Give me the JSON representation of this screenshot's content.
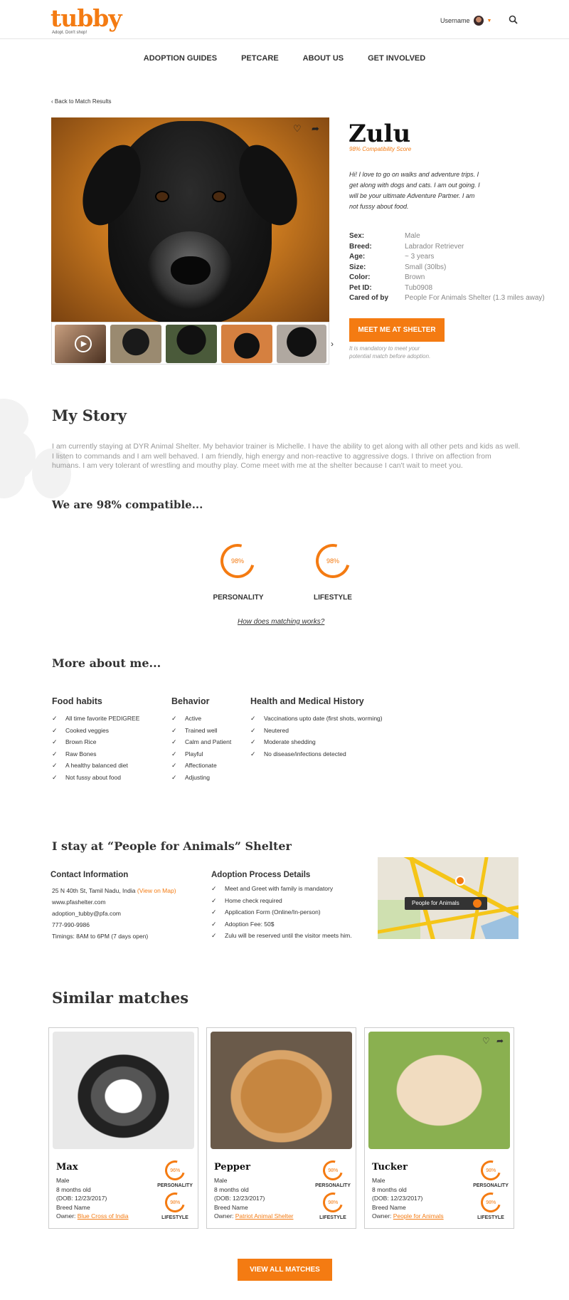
{
  "header": {
    "logo": "tubby",
    "tagline": "Adopt. Don't shop!",
    "username": "Username",
    "icons": [
      "avatar",
      "chevron-down-icon",
      "search-icon"
    ]
  },
  "nav": [
    "ADOPTION GUIDES",
    "PETCARE",
    "ABOUT US",
    "GET INVOLVED"
  ],
  "back_link": "Back to Match Results",
  "pet": {
    "name": "Zulu",
    "compatibility": "98% Compatibility Score",
    "intro": "Hi! I love to go on walks and adventure trips. I get along with dogs and cats. I am out going. I will be your ultimate Adventure Partner. I am not fussy about food.",
    "facts": [
      {
        "k": "Sex:",
        "v": "Male"
      },
      {
        "k": "Breed:",
        "v": "Labrador Retriever"
      },
      {
        "k": "Age:",
        "v": "~ 3 years"
      },
      {
        "k": "Size:",
        "v": "Small (30lbs)"
      },
      {
        "k": "Color:",
        "v": "Brown"
      },
      {
        "k": "Pet ID:",
        "v": "Tub0908"
      },
      {
        "k": "Cared of by",
        "v": "People For Animals Shelter (1.3 miles away)"
      }
    ],
    "meet_button": "MEET ME AT SHELTER",
    "mandatory_note": "It is mandatory to meet your potential match before adoption."
  },
  "story": {
    "title": "My Story",
    "text": "I am currently staying at DYR Animal Shelter. My behavior trainer is Michelle. I have the ability to get along with all other pets and kids as well.  I listen to commands and I am well behaved. I am friendly, high energy and non-reactive to aggressive dogs.  I thrive on affection from humans.  I am very tolerant of wrestling and mouthy play.  Come meet with me at the shelter because I can't wait to meet you."
  },
  "compat": {
    "title": "We are 98% compatible...",
    "personality_value": "98%",
    "personality_label": "PERSONALITY",
    "lifestyle_value": "98%",
    "lifestyle_label": "LIFESTYLE",
    "how_link": "How does matching works?"
  },
  "more": {
    "title": "More about me...",
    "food_title": "Food habits",
    "food": [
      "All time favorite PEDIGREE",
      "Cooked veggies",
      "Brown Rice",
      "Raw Bones",
      "A healthy balanced diet",
      "Not fussy about food"
    ],
    "behavior_title": "Behavior",
    "behavior": [
      "Active",
      "Trained well",
      "Calm and Patient",
      "Playful",
      "Affectionate",
      "Adjusting"
    ],
    "health_title": "Health and Medical History",
    "health": [
      "Vaccinations upto date (first shots, worming)",
      "Neutered",
      "Moderate shedding",
      "No disease/infections detected"
    ]
  },
  "shelter": {
    "title": "I stay at “People for Animals” Shelter",
    "contact_title": "Contact Information",
    "address": "25 N 40th St, Tamil Nadu, India",
    "view_map": "(View on Map)",
    "website": "www.pfashelter.com",
    "email": "adoption_tubby@pfa.com",
    "phone": "777-990-9986",
    "timings": "Timings: 8AM to 6PM (7 days open)",
    "process_title": "Adoption Process Details",
    "process": [
      "Meet and Greet with family is mandatory",
      "Home check required",
      "Application Form (Online/In-person)",
      "Adoption Fee: 50$",
      "Zulu will be reserved until the visitor meets him."
    ],
    "map_label": "People for Animals"
  },
  "similar": {
    "title": "Similar matches",
    "cards": [
      {
        "name": "Max",
        "sex": "Male",
        "age": "8 months old",
        "dob": "(DOB: 12/23/2017)",
        "breed": "Breed Name",
        "owner_label": "Owner: ",
        "owner": "Blue Cross of India",
        "personality": "96%",
        "lifestyle": "98%"
      },
      {
        "name": "Pepper",
        "sex": "Male",
        "age": "8 months old",
        "dob": "(DOB: 12/23/2017)",
        "breed": "Breed Name",
        "owner_label": "Owner: ",
        "owner": "Patriot Animal Shelter",
        "personality": "98%",
        "lifestyle": "98%"
      },
      {
        "name": "Tucker",
        "sex": "Male",
        "age": "8 months old",
        "dob": "(DOB: 12/23/2017)",
        "breed": "Breed Name",
        "owner_label": "Owner: ",
        "owner": "People for Animals",
        "personality": "98%",
        "lifestyle": "98%"
      }
    ],
    "personality_label": "PERSONALITY",
    "lifestyle_label": "LIFESTYLE",
    "view_all": "VIEW ALL MATCHES"
  },
  "colors": {
    "accent": "#f47b12"
  }
}
